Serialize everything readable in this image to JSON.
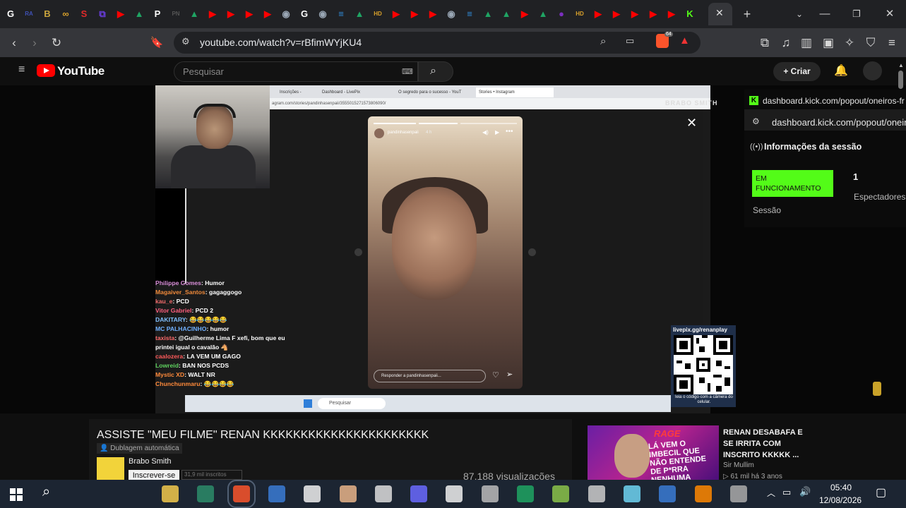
{
  "browser": {
    "tab_icons": [
      {
        "name": "google-icon",
        "color": "#ffffff",
        "glyph": "G"
      },
      {
        "name": "tab-site-icon",
        "color": "#3f51b5",
        "glyph": "RA"
      },
      {
        "name": "tab-site-icon",
        "color": "#c8a33d",
        "glyph": "B"
      },
      {
        "name": "tab-site-icon",
        "color": "#d9a12b",
        "glyph": "∞"
      },
      {
        "name": "tab-site-icon",
        "color": "#e02a2a",
        "glyph": "S"
      },
      {
        "name": "tab-site-icon",
        "color": "#6a3de0",
        "glyph": "⧉"
      },
      {
        "name": "youtube-icon",
        "color": "#ff0000",
        "glyph": "▶"
      },
      {
        "name": "drive-icon",
        "color": "#1fa463",
        "glyph": "▲"
      },
      {
        "name": "tab-site-icon",
        "color": "#ffffff",
        "glyph": "P"
      },
      {
        "name": "tab-site-icon",
        "color": "#555555",
        "glyph": "PN"
      },
      {
        "name": "drive-icon",
        "color": "#1fa463",
        "glyph": "▲"
      },
      {
        "name": "youtube-icon",
        "color": "#ff0000",
        "glyph": "▶"
      },
      {
        "name": "youtube-icon",
        "color": "#ff0000",
        "glyph": "▶"
      },
      {
        "name": "youtube-icon",
        "color": "#ff0000",
        "glyph": "▶"
      },
      {
        "name": "youtube-icon",
        "color": "#ff0000",
        "glyph": "▶"
      },
      {
        "name": "tab-site-icon",
        "color": "#9aa7b5",
        "glyph": "◉"
      },
      {
        "name": "google-icon",
        "color": "#ffffff",
        "glyph": "G"
      },
      {
        "name": "tab-site-icon",
        "color": "#9aa7b5",
        "glyph": "◉"
      },
      {
        "name": "tab-site-icon",
        "color": "#2f8ad9",
        "glyph": "≡"
      },
      {
        "name": "drive-icon",
        "color": "#1fa463",
        "glyph": "▲"
      },
      {
        "name": "tab-site-icon",
        "color": "#d9a12b",
        "glyph": "HD"
      },
      {
        "name": "youtube-icon",
        "color": "#ff0000",
        "glyph": "▶"
      },
      {
        "name": "youtube-icon",
        "color": "#ff0000",
        "glyph": "▶"
      },
      {
        "name": "youtube-icon",
        "color": "#ff0000",
        "glyph": "▶"
      },
      {
        "name": "tab-site-icon",
        "color": "#9aa7b5",
        "glyph": "◉"
      },
      {
        "name": "tab-site-icon",
        "color": "#2f8ad9",
        "glyph": "≡"
      },
      {
        "name": "drive-icon",
        "color": "#1fa463",
        "glyph": "▲"
      },
      {
        "name": "drive-icon",
        "color": "#1fa463",
        "glyph": "▲"
      },
      {
        "name": "youtube-icon",
        "color": "#ff0000",
        "glyph": "▶"
      },
      {
        "name": "drive-icon",
        "color": "#1fa463",
        "glyph": "▲"
      },
      {
        "name": "tab-site-icon",
        "color": "#7b2fbf",
        "glyph": "●"
      },
      {
        "name": "tab-site-icon",
        "color": "#d9a12b",
        "glyph": "HD"
      },
      {
        "name": "youtube-icon",
        "color": "#ff0000",
        "glyph": "▶"
      },
      {
        "name": "youtube-icon",
        "color": "#ff0000",
        "glyph": "▶"
      },
      {
        "name": "youtube-icon",
        "color": "#ff0000",
        "glyph": "▶"
      },
      {
        "name": "youtube-icon",
        "color": "#ff0000",
        "glyph": "▶"
      },
      {
        "name": "youtube-icon",
        "color": "#ff0000",
        "glyph": "▶"
      },
      {
        "name": "kick-icon",
        "color": "#53fc18",
        "glyph": "K"
      }
    ],
    "url": "youtube.com/watch?v=rBfimWYjKU4",
    "brave_badge": "64"
  },
  "youtube": {
    "logo_text": "YouTube",
    "search_placeholder": "Pesquisar",
    "create_label": "Criar"
  },
  "video_overlay": {
    "inner_tabs": [
      "Inscrições - YouTube",
      "Dashboard - LivePix",
      "O segredo para o sucesso - YouT",
      "Stories • Instagram"
    ],
    "inner_url": "agram.com/stories/pandinhasenpaii/3555015271573806090/",
    "watermark": "BRABO SMITH",
    "story_username": "pandinhasenpaii",
    "story_time": "4 h",
    "story_reply_placeholder": "Responder a pandinhasenpaii...",
    "chat": [
      {
        "user": "Philippe Gomes",
        "msg": "Humor",
        "color": "#d98fd9"
      },
      {
        "user": "Magaiver_Santos",
        "msg": "gagaggogo",
        "color": "#f08a3a"
      },
      {
        "user": "kau_e",
        "msg": "PCD",
        "color": "#f06a6a"
      },
      {
        "user": "Vitor Gabriel",
        "msg": "PCD 2",
        "color": "#ff5f7e"
      },
      {
        "user": "DAKITARY",
        "msg": "😂😂😂😂😂",
        "color": "#7fbfff"
      },
      {
        "user": "MC PALHACINHO",
        "msg": "humor",
        "color": "#6fb0ff"
      },
      {
        "user": "taxista",
        "msg": "@Guilherme Lima F xefi, bom que eu",
        "color": "#ff6a6a"
      },
      {
        "user": "",
        "msg": "printei igual o cavalão 🐴",
        "color": "#ffffff"
      },
      {
        "user": "caalozera",
        "msg": "LA VEM UM GAGO",
        "color": "#ff5a5a"
      },
      {
        "user": "Lowreid",
        "msg": "BAN NOS PCDS",
        "color": "#5fd35f"
      },
      {
        "user": "Mystic XD",
        "msg": "WALT NR",
        "color": "#ff8a3a"
      },
      {
        "user": "Chunchunmaru",
        "msg": "😂😂😂😂",
        "color": "#ff8a3a"
      }
    ],
    "qr_header": "livepix.gg/renanplay",
    "qr_caption": "leia o código com a câmera do celular."
  },
  "kick_panel": {
    "url_top": "dashboard.kick.com/popout/oneiros-fr",
    "url": "dashboard.kick.com/popout/oneiros",
    "section_title": "Informações da sessão",
    "status": "EM FUNCIONAMENTO",
    "status_label": "Sessão",
    "viewers": "1",
    "viewers_label": "Espectadores"
  },
  "video": {
    "title": "ASSISTE \"MEU FILME\" RENAN KKKKKKKKKKKKKKKKKKKKKK",
    "dub_label": "Dublagem automática",
    "channel": "Brabo Smith",
    "subscribe_label": "Inscrever-se",
    "subscribers": "31,9 mil inscritos",
    "views": "87.188 visualizações"
  },
  "recommendation": {
    "thumb_text_1": "RAGE",
    "thumb_text_2": "LÁ VEM O IMBECIL QUE NÃO ENTENDE DE P*RRA NENHUMA",
    "title": "RENAN DESABAFA E SE IRRITA COM INSCRITO KKKKK ...",
    "channel": "Sir Mullim",
    "meta": "61 mil  há 3 anos"
  },
  "taskbar": {
    "time": "05:40",
    "date": "12/08/2026"
  }
}
